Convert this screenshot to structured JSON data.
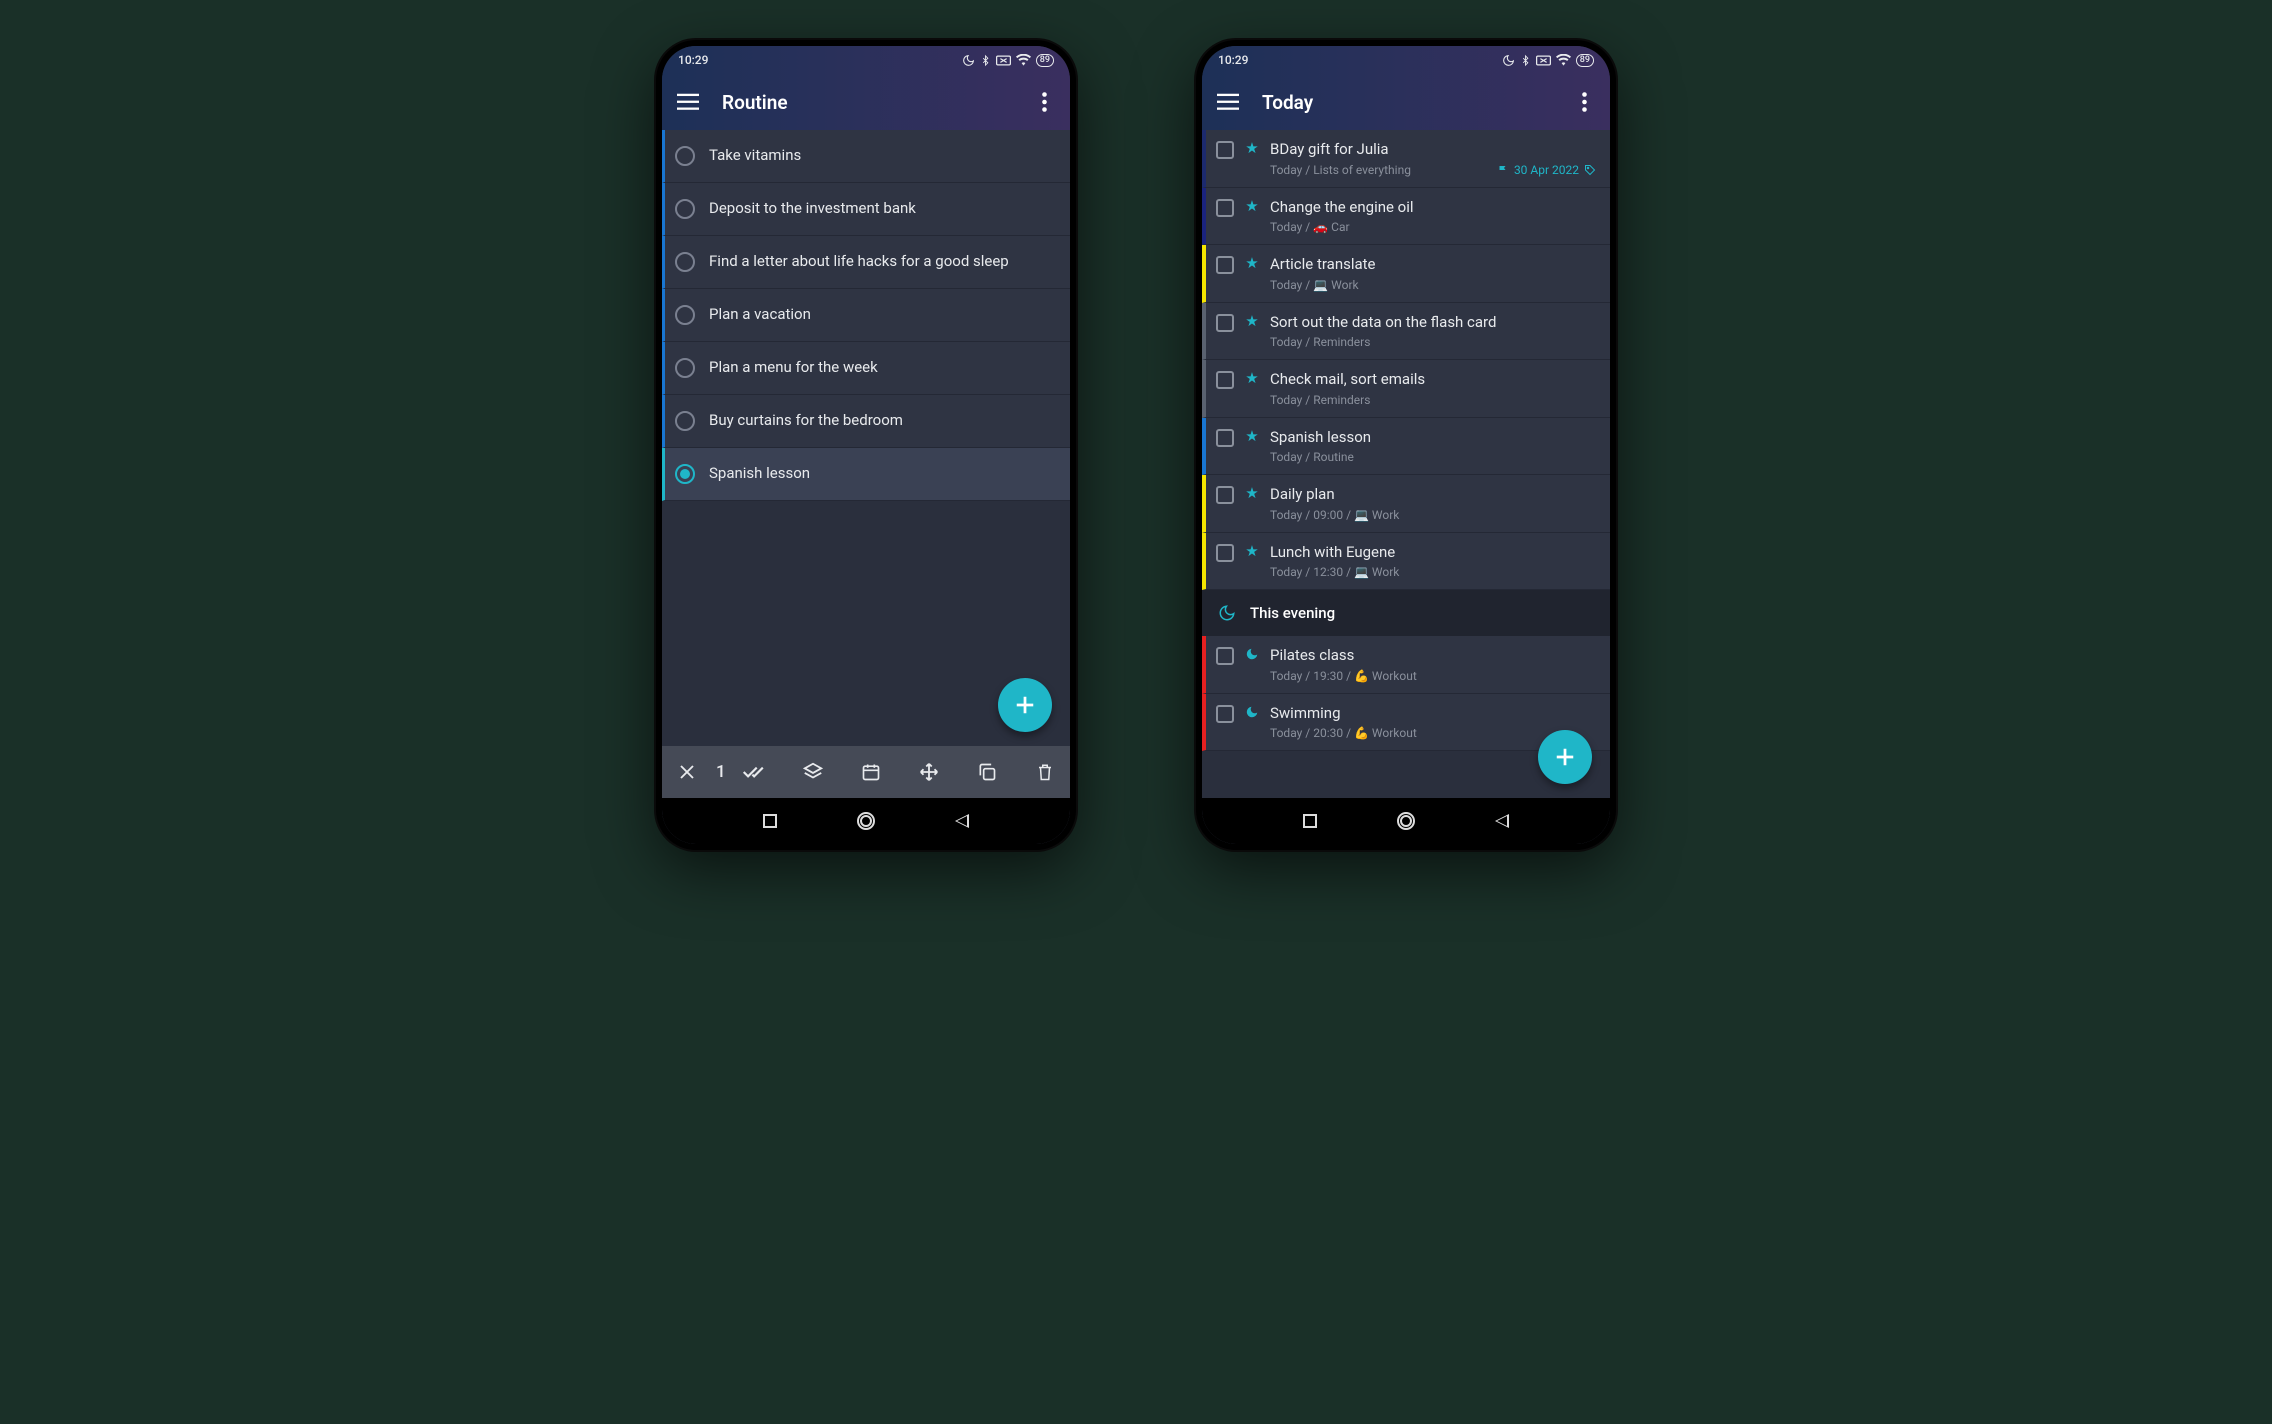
{
  "status": {
    "time": "10:29",
    "battery": "89"
  },
  "routine": {
    "title": "Routine",
    "selectionCount": "1",
    "tasks": [
      {
        "title": "Take vitamins",
        "selected": false
      },
      {
        "title": "Deposit to the investment bank",
        "selected": false
      },
      {
        "title": "Find a letter about life hacks for a good sleep",
        "selected": false
      },
      {
        "title": "Plan a vacation",
        "selected": false
      },
      {
        "title": "Plan a menu for the week",
        "selected": false
      },
      {
        "title": "Buy curtains for the bedroom",
        "selected": false
      },
      {
        "title": "Spanish lesson",
        "selected": true
      }
    ]
  },
  "today": {
    "title": "Today",
    "items": [
      {
        "title": "BDay gift for Julia",
        "meta": "Today / Lists of everything",
        "due": "30 Apr 2022",
        "stripe": "blue0",
        "marker": "star"
      },
      {
        "title": "Change the engine oil",
        "meta": "Today / 🚗 Car",
        "stripe": "blue1",
        "marker": "star"
      },
      {
        "title": "Article translate",
        "meta": "Today / 💻 Work",
        "stripe": "yellow",
        "marker": "star"
      },
      {
        "title": "Sort out the data on the flash card",
        "meta": "Today / Reminders",
        "stripe": "gray",
        "marker": "star"
      },
      {
        "title": "Check mail, sort emails",
        "meta": "Today / Reminders",
        "stripe": "gray",
        "marker": "star"
      },
      {
        "title": "Spanish lesson",
        "meta": "Today / Routine",
        "stripe": "blue-bright",
        "marker": "star"
      },
      {
        "title": "Daily plan",
        "meta": "Today / 09:00 / 💻 Work",
        "stripe": "yellow",
        "marker": "star"
      },
      {
        "title": "Lunch with Eugene",
        "meta": "Today / 12:30 / 💻 Work",
        "stripe": "yellow",
        "marker": "star"
      }
    ],
    "section": {
      "title": "This evening"
    },
    "evening": [
      {
        "title": "Pilates class",
        "meta": "Today / 19:30 / 💪 Workout",
        "stripe": "red",
        "marker": "moon"
      },
      {
        "title": "Swimming",
        "meta": "Today / 20:30 / 💪 Workout",
        "stripe": "red",
        "marker": "moon"
      }
    ]
  }
}
